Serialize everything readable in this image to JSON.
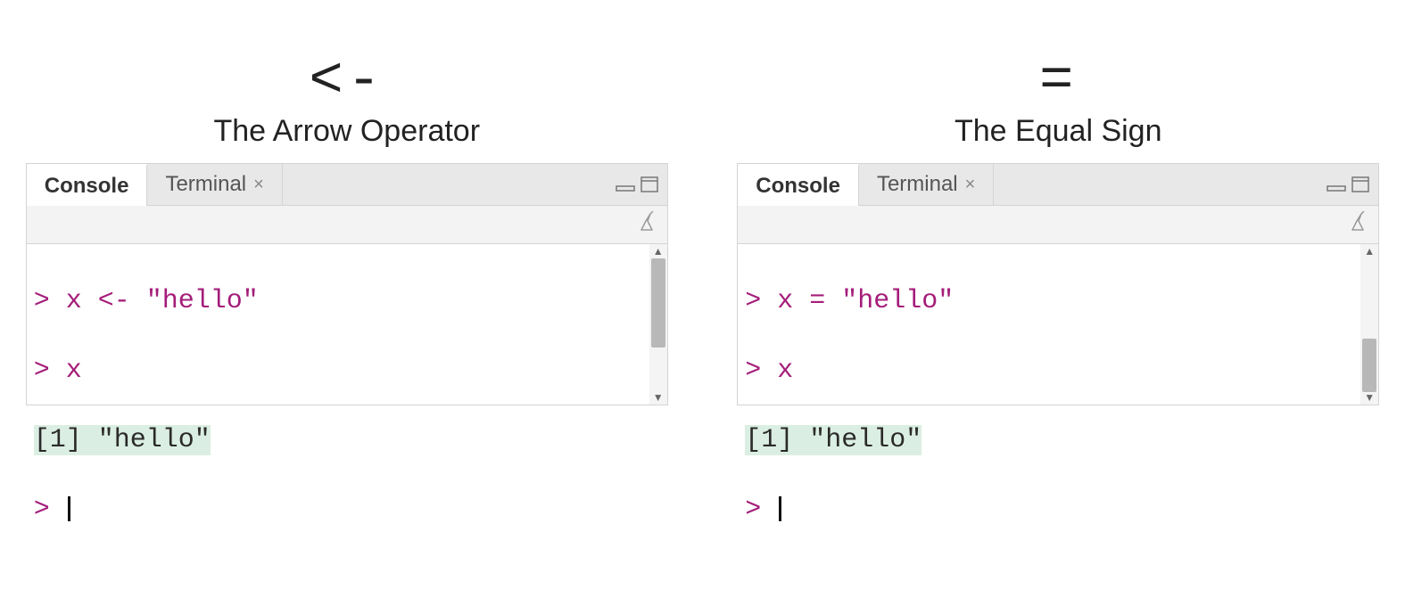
{
  "left": {
    "symbol": "<-",
    "title": "The Arrow Operator",
    "tabs": {
      "active": "Console",
      "inactive": "Terminal"
    },
    "code": {
      "l1_prompt": "> ",
      "l1_code": "x <- \"hello\"",
      "l2_prompt": "> ",
      "l2_code": "x",
      "l3_out": "[1] \"hello\"",
      "l4_prompt": "> "
    }
  },
  "right": {
    "symbol": "=",
    "title": "The Equal Sign",
    "tabs": {
      "active": "Console",
      "inactive": "Terminal"
    },
    "code": {
      "l1_prompt": "> ",
      "l1_code": "x = \"hello\"",
      "l2_prompt": "> ",
      "l2_code": "x",
      "l3_out": "[1] \"hello\"",
      "l4_prompt": "> "
    }
  }
}
